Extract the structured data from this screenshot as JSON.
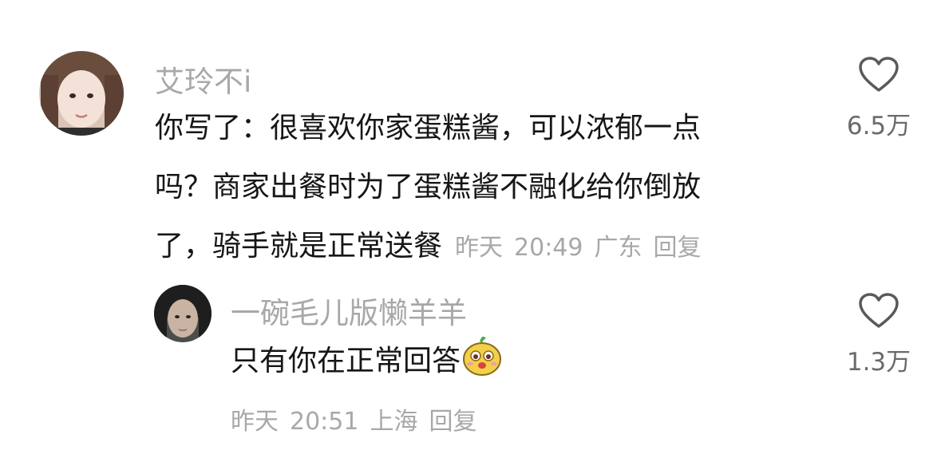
{
  "comment": {
    "username": "艾玲不i",
    "lines": [
      "你写了：很喜欢你家蛋糕酱，可以浓郁一点",
      "吗？商家出餐时为了蛋糕酱不融化给你倒放",
      "了，骑手就是正常送餐"
    ],
    "meta": {
      "date": "昨天",
      "time": "20:49",
      "location": "广东",
      "reply_label": "回复"
    },
    "like_icon": "heart-outline-icon",
    "like_count": "6.5万"
  },
  "reply": {
    "username": "一碗毛儿版懒羊羊",
    "text": "只有你在正常回答",
    "sticker_icon": "yellow-cartoon-face-emoji",
    "meta": {
      "date": "昨天",
      "time": "20:51",
      "location": "上海",
      "reply_label": "回复"
    },
    "like_icon": "heart-outline-icon",
    "like_count": "1.3万"
  },
  "colors": {
    "username": "#a8a8a8",
    "text": "#161616",
    "meta": "#a8a8a8",
    "icon": "#5a5a5a"
  }
}
